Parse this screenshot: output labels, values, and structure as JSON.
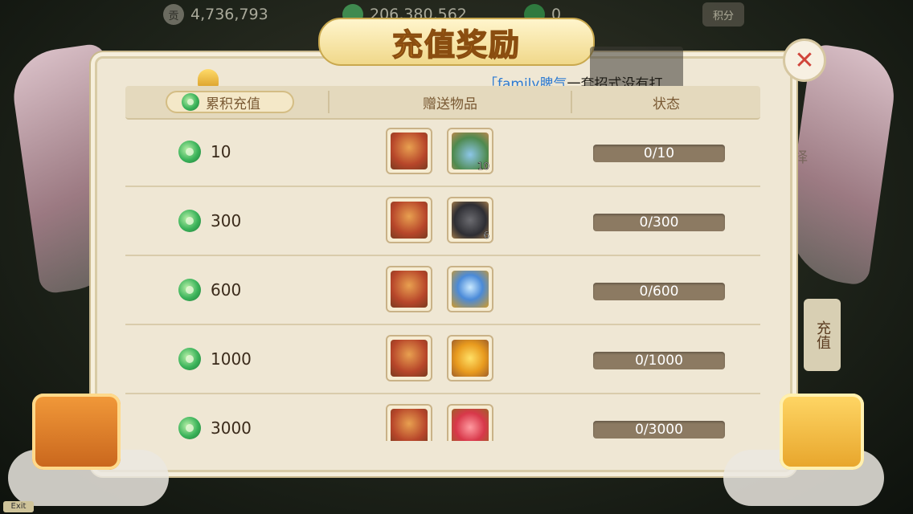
{
  "topbar": {
    "contribution": "4,736,793",
    "silver": "206,380,562",
    "jade": "0",
    "score_label": "积分"
  },
  "title": "充值奖励",
  "chat": {
    "name": "「family脾气",
    "text": "一套招式没有打"
  },
  "side": {
    "tab_recharge": "充值",
    "tab_other": "择"
  },
  "exit_label": "Exit",
  "table": {
    "headers": [
      "累积充值",
      "赠送物品",
      "状态"
    ],
    "rows": [
      {
        "amount": "10",
        "items": [
          {
            "icon": "coin-bag-icon",
            "count": ""
          },
          {
            "icon": "plant-vase-icon",
            "count": "10"
          }
        ],
        "status": "0/10"
      },
      {
        "amount": "300",
        "items": [
          {
            "icon": "coin-bag-icon",
            "count": ""
          },
          {
            "icon": "dark-stone-icon",
            "count": "6"
          }
        ],
        "status": "0/300"
      },
      {
        "amount": "600",
        "items": [
          {
            "icon": "coin-bag-icon",
            "count": ""
          },
          {
            "icon": "crystal-orb-icon",
            "count": ""
          }
        ],
        "status": "0/600"
      },
      {
        "amount": "1000",
        "items": [
          {
            "icon": "coin-bag-icon",
            "count": ""
          },
          {
            "icon": "gold-bag-icon",
            "count": ""
          }
        ],
        "status": "0/1000"
      },
      {
        "amount": "3000",
        "items": [
          {
            "icon": "coin-bag-icon",
            "count": ""
          },
          {
            "icon": "red-bag-icon",
            "count": ""
          }
        ],
        "status": "0/3000"
      }
    ]
  }
}
